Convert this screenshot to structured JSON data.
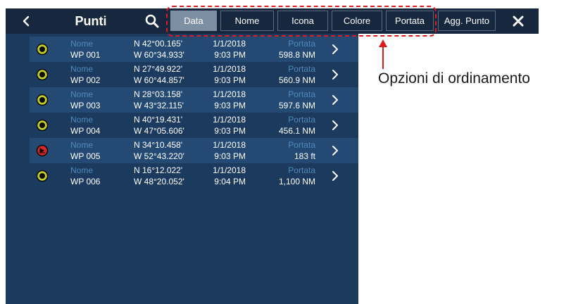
{
  "colors": {
    "panel": "#1c3a5e",
    "header": "#16273e",
    "row_alt": "#244a74",
    "field_label": "#4f88b8",
    "sort_active": "#7d8fa3",
    "annotation_red": "#e0191d",
    "wp_icon_fill": "#c5cf2a",
    "wp_icon_alert": "#d62626"
  },
  "header": {
    "back_icon": "chevron-left-icon",
    "title": "Punti",
    "search_icon": "search-icon",
    "close_icon": "close-icon"
  },
  "sort_tabs": [
    {
      "label": "Data",
      "active": true
    },
    {
      "label": "Nome",
      "active": false
    },
    {
      "label": "Icona",
      "active": false
    },
    {
      "label": "Colore",
      "active": false
    },
    {
      "label": "Portata",
      "active": false
    }
  ],
  "add_button_label": "Agg. Punto",
  "waypoints": [
    {
      "name_label": "Nome",
      "name": "WP 001",
      "lat": "N 42°00.165'",
      "lon": "W 60°34.933'",
      "date": "1/1/2018",
      "time": "9:03 PM",
      "range_label": "Portata",
      "range": "598.8 NM",
      "icon": "waypoint-circle-icon"
    },
    {
      "name_label": "Nome",
      "name": "WP 002",
      "lat": "N 27°49.922'",
      "lon": "W 60°44.857'",
      "date": "1/1/2018",
      "time": "9:03 PM",
      "range_label": "Portata",
      "range": "560.9 NM",
      "icon": "waypoint-circle-icon"
    },
    {
      "name_label": "Nome",
      "name": "WP 003",
      "lat": "N 28°03.158'",
      "lon": "W 43°32.115'",
      "date": "1/1/2018",
      "time": "9:03 PM",
      "range_label": "Portata",
      "range": "597.6 NM",
      "icon": "waypoint-circle-icon"
    },
    {
      "name_label": "Nome",
      "name": "WP 004",
      "lat": "N 40°19.431'",
      "lon": "W 47°05.606'",
      "date": "1/1/2018",
      "time": "9:03 PM",
      "range_label": "Portata",
      "range": "456.1 NM",
      "icon": "waypoint-circle-icon"
    },
    {
      "name_label": "Nome",
      "name": "WP 005",
      "lat": "N 34°10.458'",
      "lon": "W 52°43.220'",
      "date": "1/1/2018",
      "time": "9:03 PM",
      "range_label": "Portata",
      "range": "183 ft",
      "icon": "waypoint-alert-icon"
    },
    {
      "name_label": "Nome",
      "name": "WP 006",
      "lat": "N 16°12.022'",
      "lon": "W 48°20.052'",
      "date": "1/1/2018",
      "time": "9:04 PM",
      "range_label": "Portata",
      "range": "1,100 NM",
      "icon": "waypoint-circle-icon"
    }
  ],
  "annotation": {
    "text": "Opzioni di ordinamento"
  }
}
